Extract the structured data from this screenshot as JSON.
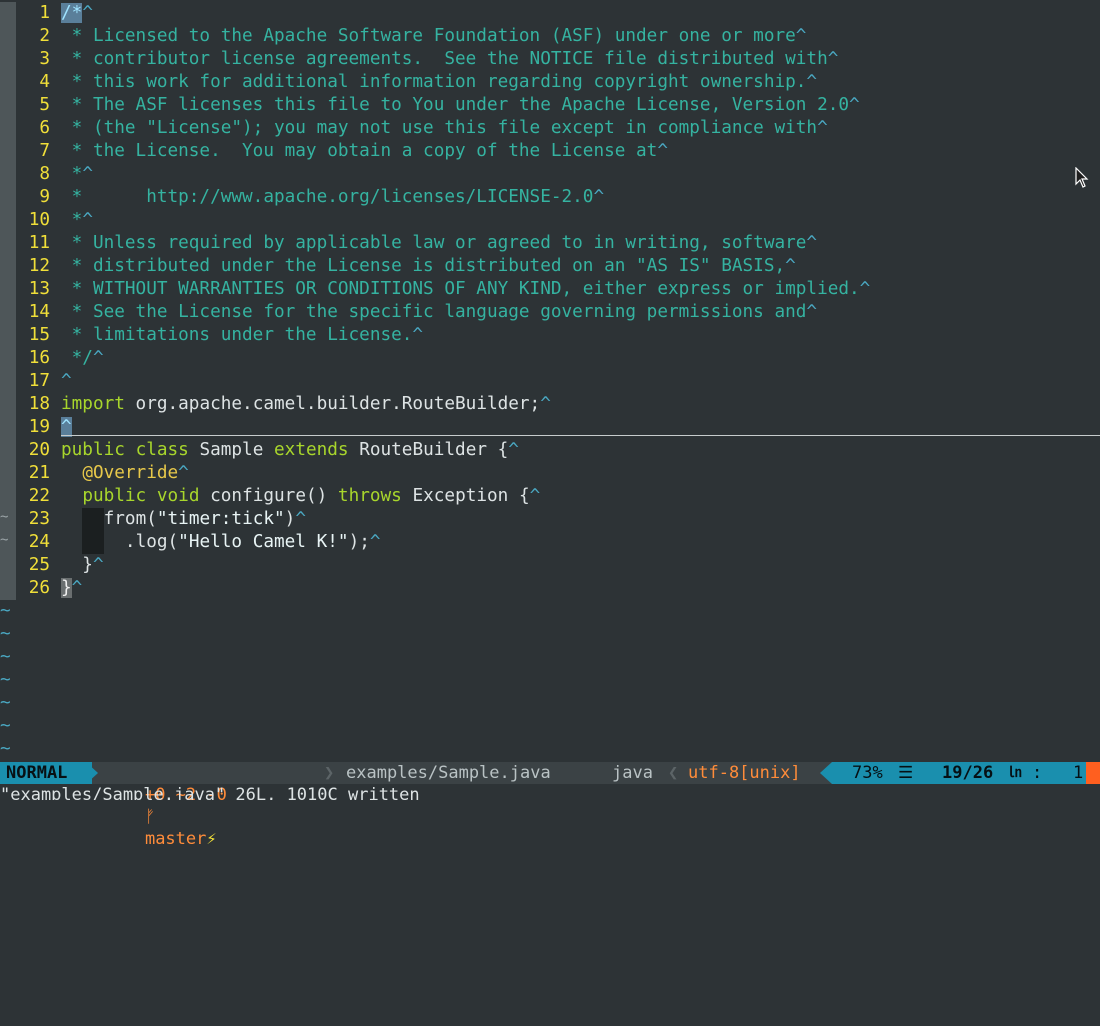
{
  "editor": {
    "lines": [
      {
        "n": "1",
        "parts": [
          {
            "t": "/*",
            "c": "com cursor-cell"
          },
          {
            "t": "^",
            "c": "eol"
          }
        ]
      },
      {
        "n": "2",
        "parts": [
          {
            "t": " * Licensed to the Apache Software Foundation (ASF) under one or more",
            "c": "com"
          },
          {
            "t": "^",
            "c": "eol"
          }
        ]
      },
      {
        "n": "3",
        "parts": [
          {
            "t": " * contributor license agreements.  See the NOTICE file distributed with",
            "c": "com"
          },
          {
            "t": "^",
            "c": "eol"
          }
        ]
      },
      {
        "n": "4",
        "parts": [
          {
            "t": " * this work for additional information regarding copyright ownership.",
            "c": "com"
          },
          {
            "t": "^",
            "c": "eol"
          }
        ]
      },
      {
        "n": "5",
        "parts": [
          {
            "t": " * The ASF licenses this file to You under the Apache License, Version 2.0",
            "c": "com"
          },
          {
            "t": "^",
            "c": "eol"
          }
        ]
      },
      {
        "n": "6",
        "parts": [
          {
            "t": " * (the \"License\"); you may not use this file except in compliance with",
            "c": "com"
          },
          {
            "t": "^",
            "c": "eol"
          }
        ]
      },
      {
        "n": "7",
        "parts": [
          {
            "t": " * the License.  You may obtain a copy of the License at",
            "c": "com"
          },
          {
            "t": "^",
            "c": "eol"
          }
        ]
      },
      {
        "n": "8",
        "parts": [
          {
            "t": " *",
            "c": "com"
          },
          {
            "t": "^",
            "c": "eol"
          }
        ]
      },
      {
        "n": "9",
        "parts": [
          {
            "t": " *      http://www.apache.org/licenses/LICENSE-2.0",
            "c": "com"
          },
          {
            "t": "^",
            "c": "eol"
          }
        ]
      },
      {
        "n": "10",
        "parts": [
          {
            "t": " *",
            "c": "com"
          },
          {
            "t": "^",
            "c": "eol"
          }
        ]
      },
      {
        "n": "11",
        "parts": [
          {
            "t": " * Unless required by applicable law or agreed to in writing, software",
            "c": "com"
          },
          {
            "t": "^",
            "c": "eol"
          }
        ]
      },
      {
        "n": "12",
        "parts": [
          {
            "t": " * distributed under the License is distributed on an \"AS IS\" BASIS,",
            "c": "com"
          },
          {
            "t": "^",
            "c": "eol"
          }
        ]
      },
      {
        "n": "13",
        "parts": [
          {
            "t": " * WITHOUT WARRANTIES OR CONDITIONS OF ANY KIND, either express or implied.",
            "c": "com"
          },
          {
            "t": "^",
            "c": "eol"
          }
        ]
      },
      {
        "n": "14",
        "parts": [
          {
            "t": " * See the License for the specific language governing permissions and",
            "c": "com"
          },
          {
            "t": "^",
            "c": "eol"
          }
        ]
      },
      {
        "n": "15",
        "parts": [
          {
            "t": " * limitations under the License.",
            "c": "com"
          },
          {
            "t": "^",
            "c": "eol"
          }
        ]
      },
      {
        "n": "16",
        "parts": [
          {
            "t": " */",
            "c": "com"
          },
          {
            "t": "^",
            "c": "eol"
          }
        ]
      },
      {
        "n": "17",
        "parts": [
          {
            "t": "^",
            "c": "eol"
          }
        ]
      },
      {
        "n": "18",
        "parts": [
          {
            "t": "import",
            "c": "kw"
          },
          {
            "t": " org.apache.camel.builder.RouteBuilder;",
            "c": "plain"
          },
          {
            "t": "^",
            "c": "eol"
          }
        ]
      },
      {
        "n": "19",
        "parts": [
          {
            "t": "^",
            "c": "eol cursor-cell"
          }
        ]
      },
      {
        "n": "20",
        "parts": [
          {
            "t": "public",
            "c": "kw"
          },
          {
            "t": " ",
            "c": "plain"
          },
          {
            "t": "class",
            "c": "kw"
          },
          {
            "t": " Sample ",
            "c": "plain"
          },
          {
            "t": "extends",
            "c": "kw"
          },
          {
            "t": " RouteBuilder {",
            "c": "plain"
          },
          {
            "t": "^",
            "c": "eol"
          }
        ]
      },
      {
        "n": "21",
        "parts": [
          {
            "t": "  ",
            "c": "plain"
          },
          {
            "t": "@Override",
            "c": "ann"
          },
          {
            "t": "^",
            "c": "eol"
          }
        ]
      },
      {
        "n": "22",
        "parts": [
          {
            "t": "  ",
            "c": "plain"
          },
          {
            "t": "public",
            "c": "kw"
          },
          {
            "t": " ",
            "c": "plain"
          },
          {
            "t": "void",
            "c": "kw"
          },
          {
            "t": " configure() ",
            "c": "plain"
          },
          {
            "t": "throws",
            "c": "kw"
          },
          {
            "t": " Exception {",
            "c": "plain"
          },
          {
            "t": "^",
            "c": "eol"
          }
        ]
      },
      {
        "n": "23",
        "sign": "~",
        "parts": [
          {
            "t": "  ",
            "c": "plain"
          },
          {
            "t": "  ",
            "c": "indent-block"
          },
          {
            "t": "from(",
            "c": "plain"
          },
          {
            "t": "\"timer:tick\"",
            "c": "str"
          },
          {
            "t": ")",
            "c": "plain"
          },
          {
            "t": "^",
            "c": "eol"
          }
        ]
      },
      {
        "n": "24",
        "sign": "~",
        "parts": [
          {
            "t": "  ",
            "c": "plain"
          },
          {
            "t": "  ",
            "c": "indent-block"
          },
          {
            "t": "  .log(",
            "c": "plain"
          },
          {
            "t": "\"Hello Camel K!\"",
            "c": "str"
          },
          {
            "t": ");",
            "c": "plain"
          },
          {
            "t": "^",
            "c": "eol"
          }
        ]
      },
      {
        "n": "25",
        "parts": [
          {
            "t": "  }",
            "c": "plain"
          },
          {
            "t": "^",
            "c": "eol"
          }
        ]
      },
      {
        "n": "26",
        "parts": [
          {
            "t": "}",
            "c": "brace-hl"
          },
          {
            "t": "^",
            "c": "eol"
          }
        ]
      }
    ],
    "tildes": [
      "~",
      "~",
      "~",
      "~",
      "~",
      "~",
      "~"
    ]
  },
  "statusline": {
    "mode": "NORMAL",
    "git_changes": "+0 ~2 -0",
    "branch_icon": "ᚠ",
    "branch": "master",
    "branch_flag": "⚡",
    "separator": "",
    "filename": "examples/Sample.java",
    "filetype": "java",
    "encoding": "utf-8[unix]",
    "percent": "73%",
    "percent_icon": "☰",
    "position": "19/26",
    "ln_icon": "㏑",
    "col_sep": ":",
    "column": "1"
  },
  "cmdline": {
    "message": "\"examples/Sample.java\" 26L, 1010C written"
  },
  "colors": {
    "background": "#2d3336",
    "comment": "#35b3a1",
    "keyword": "#a8d62c",
    "line_number": "#f0df39",
    "mode_bg": "#1a8fae",
    "git_orange": "#ff8c3a"
  }
}
